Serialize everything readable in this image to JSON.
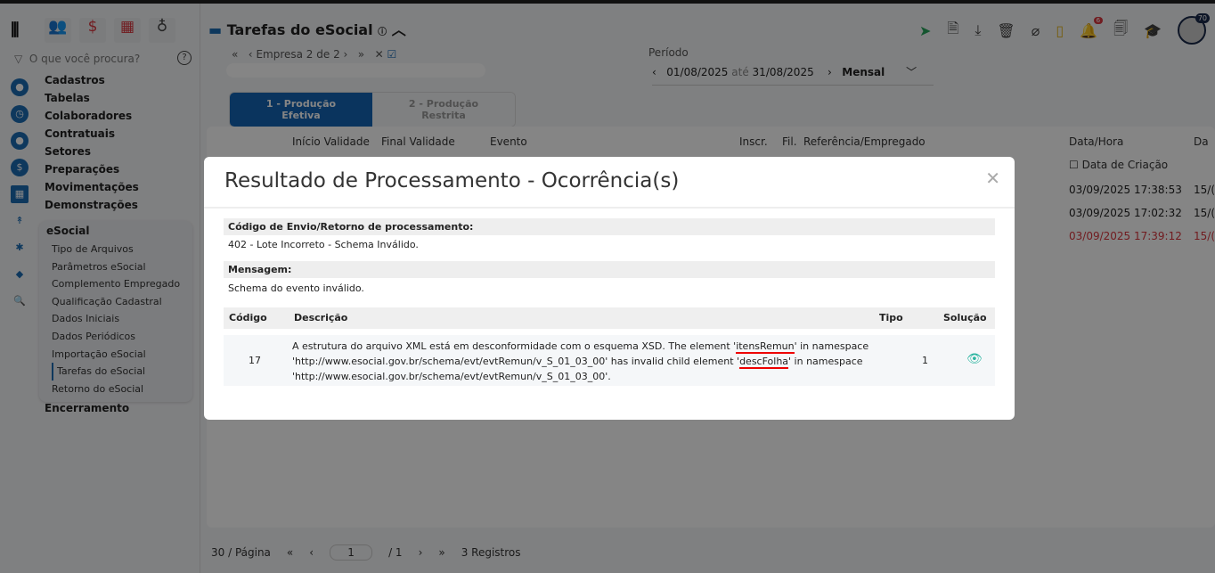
{
  "sidebar": {
    "search_placeholder": "O que você procura?",
    "menu": [
      "Cadastros",
      "Tabelas",
      "Colaboradores",
      "Contratuais",
      "Setores",
      "Preparações",
      "Movimentações",
      "Demonstrações"
    ],
    "group": "eSocial",
    "sub": [
      "Tipo de Arquivos",
      "Parâmetros eSocial",
      "Complemento Empregado",
      "Qualificação Cadastral",
      "Dados Iniciais",
      "Dados Periódicos",
      "Importação eSocial",
      "Tarefas do eSocial",
      "Retorno do eSocial"
    ],
    "last": "Encerramento"
  },
  "header": {
    "title": "Tarefas do eSocial",
    "notif_count": "6",
    "avatar_badge": "70"
  },
  "empresa": {
    "label": "Empresa 2 de 2"
  },
  "periodo": {
    "label": "Período",
    "from": "01/08/2025",
    "sep": "até",
    "to": "31/08/2025",
    "mode": "Mensal"
  },
  "tabs": [
    "1 - Produção Efetiva",
    "2 - Produção Restrita"
  ],
  "grid": {
    "headers": [
      "Início Validade",
      "Final Validade",
      "Evento",
      "Inscr.",
      "Fil.",
      "Referência/Empregado",
      "Data/Hora",
      "Da"
    ],
    "filter": "Data de Criação",
    "rows": [
      "03/09/2025 17:38:53",
      "03/09/2025 17:02:32",
      "03/09/2025 17:39:12"
    ],
    "extra": [
      "15/(",
      "15/(",
      "15/("
    ]
  },
  "pagination": {
    "per_page": "30 / Página",
    "page": "1",
    "total_pages": "/ 1",
    "records": "3 Registros"
  },
  "modal": {
    "title": "Resultado de Processamento - Ocorrência(s)",
    "code_label": "Código de Envio/Retorno de processamento:",
    "code_value": "402 - Lote Incorreto - Schema Inválido.",
    "msg_label": "Mensagem:",
    "msg_value": "Schema do evento inválido.",
    "cols": [
      "Código",
      "Descrição",
      "Tipo",
      "Solução"
    ],
    "row": {
      "code": "17",
      "d1": "A estrutura do arquivo XML está em desconformidade com o esquema XSD. The element '",
      "e1": "itensRemun",
      "d2": "' in namespace 'http://www.esocial.gov.br/schema/evt/evtRemun/v_S_01_03_00' has invalid child element '",
      "e2": "descFolha",
      "d3": "' in namespace 'http://www.esocial.gov.br/schema/evt/evtRemun/v_S_01_03_00'.",
      "tipo": "1"
    }
  }
}
